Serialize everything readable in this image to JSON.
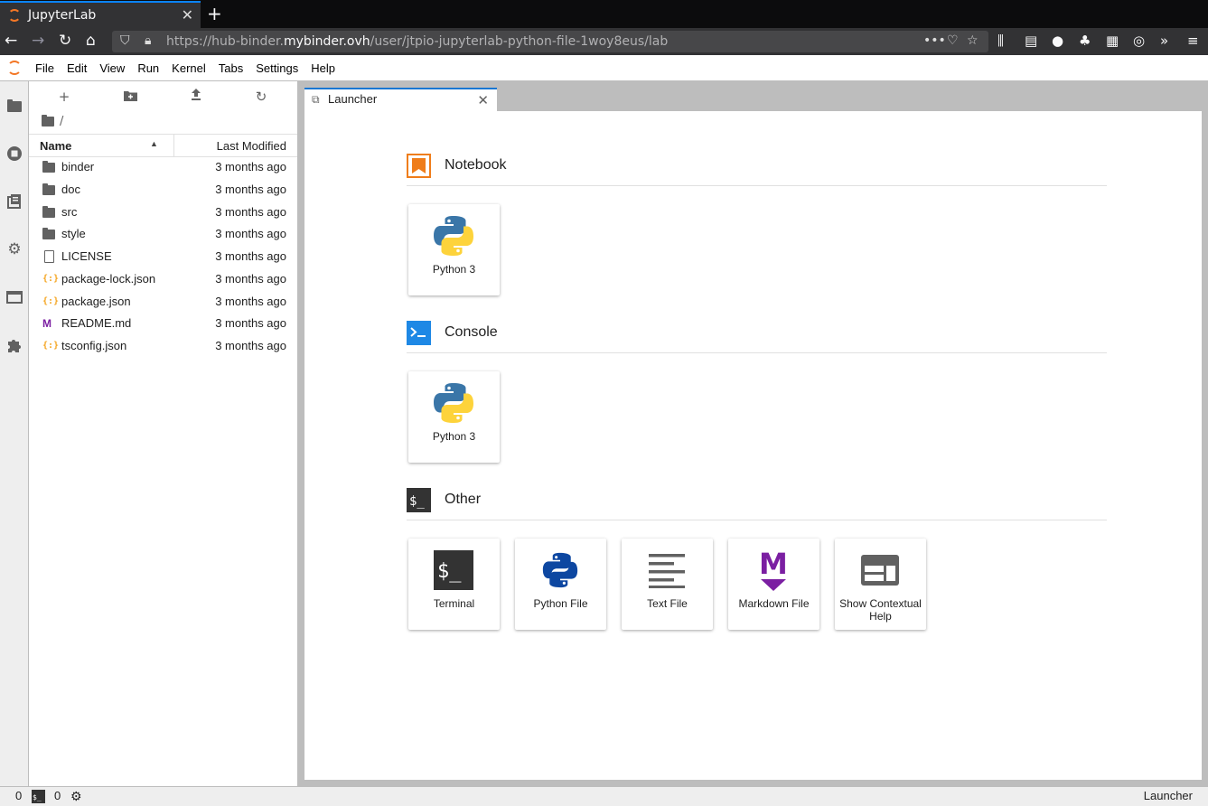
{
  "browser": {
    "tab_title": "JupyterLab",
    "url_prefix": "https://hub-binder.",
    "url_domain": "mybinder.ovh",
    "url_path": "/user/jtpio-jupyterlab-python-file-1woy8eus/lab"
  },
  "menu": [
    "File",
    "Edit",
    "View",
    "Run",
    "Kernel",
    "Tabs",
    "Settings",
    "Help"
  ],
  "filebrowser": {
    "path": "/",
    "col_name": "Name",
    "col_modified": "Last Modified",
    "files": [
      {
        "name": "binder",
        "type": "folder",
        "modified": "3 months ago"
      },
      {
        "name": "doc",
        "type": "folder",
        "modified": "3 months ago"
      },
      {
        "name": "src",
        "type": "folder",
        "modified": "3 months ago"
      },
      {
        "name": "style",
        "type": "folder",
        "modified": "3 months ago"
      },
      {
        "name": "LICENSE",
        "type": "file",
        "modified": "3 months ago"
      },
      {
        "name": "package-lock.json",
        "type": "json",
        "modified": "3 months ago"
      },
      {
        "name": "package.json",
        "type": "json",
        "modified": "3 months ago"
      },
      {
        "name": "README.md",
        "type": "markdown",
        "modified": "3 months ago"
      },
      {
        "name": "tsconfig.json",
        "type": "json",
        "modified": "3 months ago"
      }
    ]
  },
  "dock": {
    "tab_label": "Launcher"
  },
  "launcher": {
    "notebook": {
      "title": "Notebook",
      "cards": [
        {
          "label": "Python 3"
        }
      ]
    },
    "console": {
      "title": "Console",
      "cards": [
        {
          "label": "Python 3"
        }
      ]
    },
    "other": {
      "title": "Other",
      "cards": [
        {
          "label": "Terminal"
        },
        {
          "label": "Python File"
        },
        {
          "label": "Text File"
        },
        {
          "label": "Markdown File"
        },
        {
          "label": "Show Contextual Help"
        }
      ]
    }
  },
  "statusbar": {
    "kernels_count": "0",
    "terminals_count": "0",
    "mode": "Launcher"
  },
  "colors": {
    "accent": "#1976d2",
    "jupyter_orange": "#f37726",
    "markdown_purple": "#7b1fa2"
  }
}
